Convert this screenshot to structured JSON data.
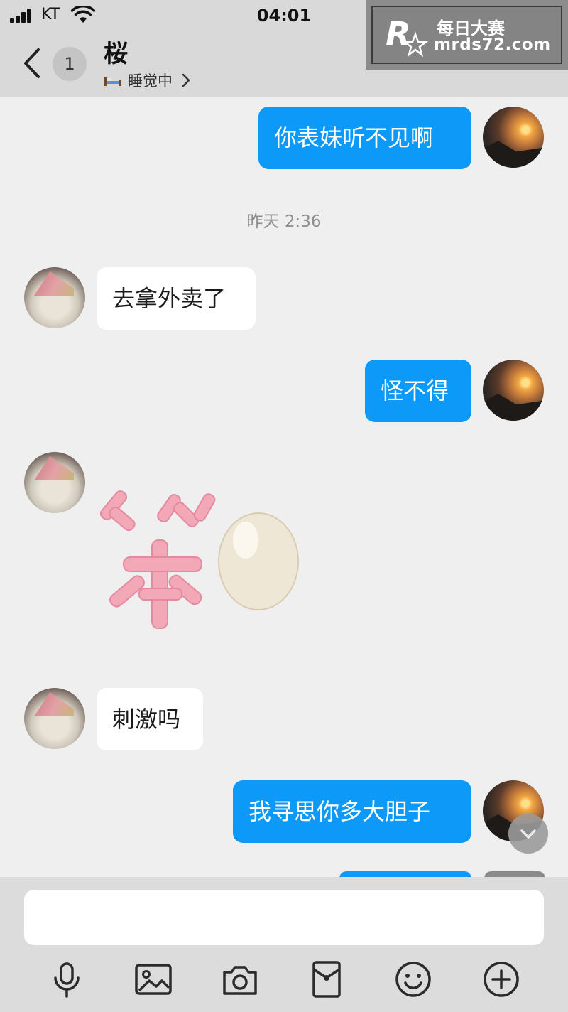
{
  "status_bar": {
    "carrier": "KT",
    "time": "04:01"
  },
  "header": {
    "unread_count": "1",
    "contact_name": "桜",
    "contact_status": "睡觉中"
  },
  "watermark": {
    "title": "每日大赛",
    "url": "mrds72.com"
  },
  "messages": [
    {
      "direction": "out",
      "text": "你表妹听不见啊"
    },
    {
      "direction": "in",
      "text": "去拿外卖了"
    },
    {
      "direction": "out",
      "text": "怪不得"
    },
    {
      "direction": "in",
      "type": "sticker",
      "sticker": "笨蛋 (pink strokes + egg)"
    },
    {
      "direction": "in",
      "text": "刺激吗"
    },
    {
      "direction": "out",
      "text": "我寻思你多大胆子"
    }
  ],
  "time_separator": "昨天 2:36",
  "composer": {
    "placeholder": "",
    "tools": [
      "microphone-icon",
      "image-icon",
      "camera-icon",
      "red-packet-icon",
      "emoji-icon",
      "plus-icon"
    ]
  },
  "colors": {
    "outgoing_bubble": "#0c99f7",
    "incoming_bubble": "#ffffff",
    "background": "#efefef",
    "header": "#d9d9d9"
  }
}
